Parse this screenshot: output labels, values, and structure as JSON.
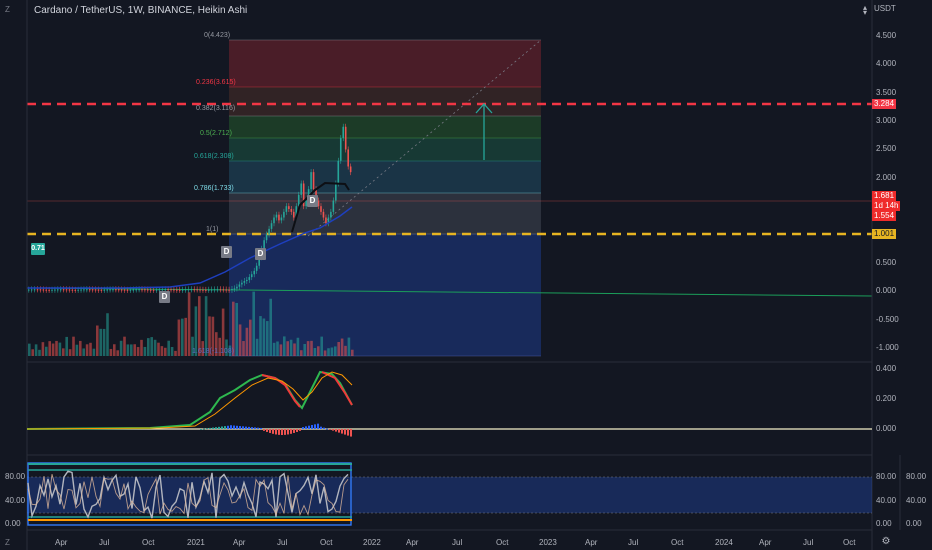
{
  "header": {
    "title": "Cardano / TetherUS, 1W, BINANCE, Heikin Ashi",
    "currency": "USDT",
    "chevron": "chevron-up-down-icon"
  },
  "price_axis": {
    "labels": [
      "4.500",
      "4.000",
      "3.500",
      "3.000",
      "2.500",
      "2.000",
      "1.500",
      "1.000",
      "0.500",
      "0.000",
      "-0.500",
      "-1.000"
    ],
    "values": [
      4.5,
      4.0,
      3.5,
      3.0,
      2.5,
      2.0,
      1.5,
      1.0,
      0.5,
      0.0,
      -0.5,
      -1.0
    ]
  },
  "price_tags": {
    "upper_line": "3.284",
    "last_price": "1.681",
    "countdown": "1d 14h",
    "low_price": "1.554",
    "lower_line": "1.001"
  },
  "fib_levels": [
    {
      "label": "0(4.423)",
      "value": 4.423
    },
    {
      "label": "0.236(3.615)",
      "value": 3.615
    },
    {
      "label": "0.382(3.116)",
      "value": 3.116
    },
    {
      "label": "0.5(2.712)",
      "value": 2.712
    },
    {
      "label": "0.618(2.308)",
      "value": 2.308
    },
    {
      "label": "0.786(1.733)",
      "value": 1.733
    },
    {
      "label": "1(1)",
      "value": 1.0
    }
  ],
  "fib_bottom_label": "1.618(-1.108)",
  "left_tag": "0.71",
  "markers": [
    "D",
    "D",
    "D",
    "D"
  ],
  "macd_axis": {
    "labels": [
      "0.400",
      "0.200",
      "0.000"
    ],
    "values": [
      0.4,
      0.2,
      0.0
    ]
  },
  "stoch_axis": {
    "labels": [
      "80.00",
      "40.00",
      "0.00"
    ],
    "values": [
      80,
      40,
      0
    ]
  },
  "time_axis": [
    "Apr",
    "Jul",
    "Oct",
    "2021",
    "Apr",
    "Jul",
    "Oct",
    "2022",
    "Apr",
    "Jul",
    "Oct",
    "2023",
    "Apr",
    "Jul",
    "Oct",
    "2024",
    "Apr",
    "Jul",
    "Oct"
  ],
  "left_buttons": {
    "top": "Z",
    "bottom": "Z",
    "gear": "gear-icon"
  },
  "colors": {
    "bg": "#131722",
    "up": "#26a69a",
    "down": "#ef5350",
    "dashed_red": "#f23645",
    "dashed_yellow": "#e6b422",
    "ma_blue": "#1e3fbf",
    "ma_green": "#1b9e5a",
    "macd_green": "#26a65a",
    "signal_orange": "#ff9800",
    "stoch_box": "#3179f5"
  }
}
